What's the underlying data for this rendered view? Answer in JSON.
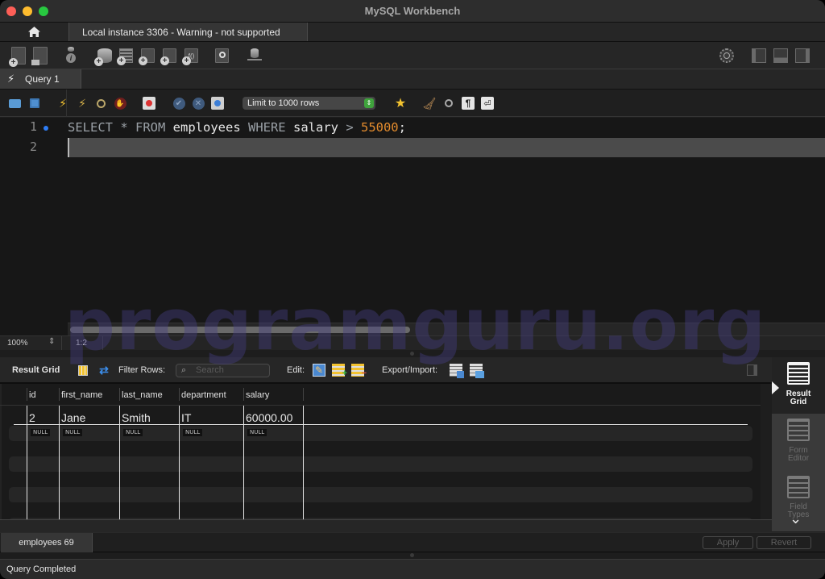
{
  "window": {
    "title": "MySQL Workbench",
    "traffic_lights": [
      "close",
      "minimize",
      "maximize"
    ]
  },
  "connection_tabs": {
    "home_icon": "home-icon",
    "active_tab": "Local instance 3306 - Warning - not supported"
  },
  "main_toolbar": {
    "buttons": [
      {
        "name": "new-sql-tab",
        "icon": "sql-file-plus-icon"
      },
      {
        "name": "open-sql-script",
        "icon": "sql-file-open-icon"
      },
      {
        "name": "schema-inspector",
        "icon": "info-icon"
      },
      {
        "name": "create-schema",
        "icon": "database-plus-icon"
      },
      {
        "name": "create-table",
        "icon": "table-plus-icon"
      },
      {
        "name": "create-view",
        "icon": "view-plus-icon"
      },
      {
        "name": "create-procedure",
        "icon": "procedure-plus-icon"
      },
      {
        "name": "create-function",
        "icon": "function-plus-icon"
      },
      {
        "name": "search-table-data",
        "icon": "table-search-icon"
      },
      {
        "name": "reconnect",
        "icon": "db-reconnect-icon"
      }
    ],
    "right_buttons": [
      "preferences-icon",
      "toggle-sidebar-icon",
      "toggle-output-icon",
      "toggle-secondary-sidebar-icon"
    ]
  },
  "query_tabs": [
    {
      "label": "Query 1",
      "icon": "lightning-icon",
      "active": true
    }
  ],
  "sql_toolbar": {
    "limit_select": "Limit to 1000 rows",
    "buttons": [
      "open-file-icon",
      "save-file-icon",
      "execute-icon",
      "execute-current-icon",
      "explain-icon",
      "stop-icon",
      "toggle-continue-on-error-icon",
      "commit-icon",
      "rollback-icon",
      "autocommit-icon",
      "add-snippet-icon",
      "beautify-icon",
      "find-icon",
      "invisible-chars-icon",
      "wrap-lines-icon"
    ]
  },
  "editor": {
    "lines": [
      {
        "number": "1",
        "has_marker": true,
        "tokens": [
          {
            "text": "SELECT",
            "type": "kw"
          },
          {
            "text": " * ",
            "type": "kw"
          },
          {
            "text": "FROM",
            "type": "kw"
          },
          {
            "text": " employees ",
            "type": "ident"
          },
          {
            "text": "WHERE",
            "type": "kw"
          },
          {
            "text": " salary ",
            "type": "ident"
          },
          {
            "text": "> ",
            "type": "kw"
          },
          {
            "text": "55000",
            "type": "num"
          },
          {
            "text": ";",
            "type": "ident"
          }
        ]
      },
      {
        "number": "2",
        "has_marker": false,
        "tokens": []
      }
    ],
    "watermark": "programguru.org",
    "zoom": "100%",
    "cursor_position": "1:2"
  },
  "result_toolbar": {
    "title": "Result Grid",
    "filter_label": "Filter Rows:",
    "search_placeholder": "Search",
    "edit_label": "Edit:",
    "export_label": "Export/Import:"
  },
  "result_grid": {
    "columns": [
      "id",
      "first_name",
      "last_name",
      "department",
      "salary"
    ],
    "rows": [
      [
        "2",
        "Jane",
        "Smith",
        "IT",
        "60000.00"
      ]
    ],
    "new_row_placeholder": [
      "NULL",
      "NULL",
      "NULL",
      "NULL",
      "NULL"
    ]
  },
  "side_panel": {
    "items": [
      {
        "label_line1": "Result",
        "label_line2": "Grid",
        "active": true
      },
      {
        "label_line1": "Form",
        "label_line2": "Editor",
        "active": false
      },
      {
        "label_line1": "Field",
        "label_line2": "Types",
        "active": false
      }
    ]
  },
  "result_tabs": {
    "active_tab": "employees 69",
    "apply_label": "Apply",
    "revert_label": "Revert"
  },
  "status_bar": {
    "text": "Query Completed"
  }
}
